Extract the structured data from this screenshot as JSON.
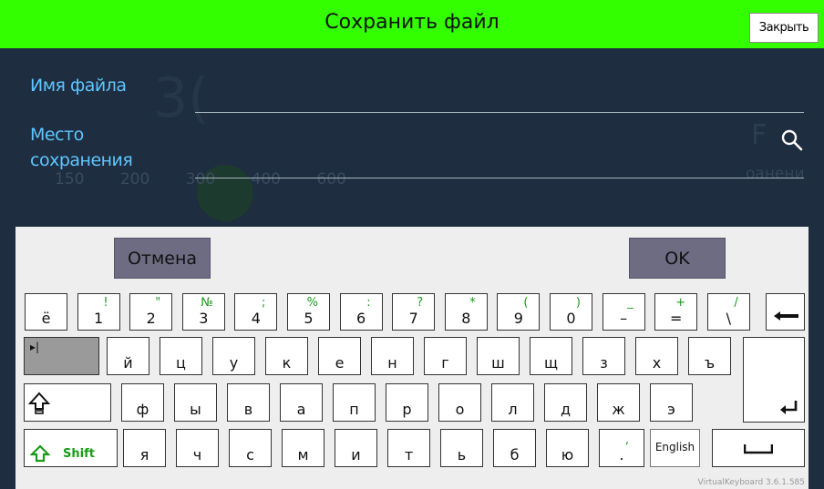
{
  "window": {
    "title": "Сохранить файл",
    "close_label": "Закрыть"
  },
  "background": {
    "big_number": "3(",
    "letter": "F",
    "numbers": "150 200 300 400 600",
    "right_text": "оанени"
  },
  "form": {
    "filename_label": "Имя файла",
    "filename_value": "",
    "location_label_line1": "Место",
    "location_label_line2": "сохранения",
    "location_value": ""
  },
  "keyboard": {
    "cancel_label": "Отмена",
    "ok_label": "OK",
    "version": "VirtualKeyboard 3.6.1.585",
    "shift_label": "Shift",
    "language_label": "English",
    "tab_symbol": "▸|",
    "row1": [
      {
        "main": "ё",
        "sub": ""
      },
      {
        "main": "1",
        "sub": "!"
      },
      {
        "main": "2",
        "sub": "\""
      },
      {
        "main": "3",
        "sub": "№"
      },
      {
        "main": "4",
        "sub": ";"
      },
      {
        "main": "5",
        "sub": "%"
      },
      {
        "main": "6",
        "sub": ":"
      },
      {
        "main": "7",
        "sub": "?"
      },
      {
        "main": "8",
        "sub": "*"
      },
      {
        "main": "9",
        "sub": "("
      },
      {
        "main": "0",
        "sub": ")"
      },
      {
        "main": "–",
        "sub": "_"
      },
      {
        "main": "=",
        "sub": "+"
      },
      {
        "main": "\\",
        "sub": "/"
      }
    ],
    "row2": [
      "й",
      "ц",
      "у",
      "к",
      "е",
      "н",
      "г",
      "ш",
      "щ",
      "з",
      "х",
      "ъ"
    ],
    "row3": [
      "ф",
      "ы",
      "в",
      "а",
      "п",
      "р",
      "о",
      "л",
      "д",
      "ж",
      "э"
    ],
    "row4": [
      "я",
      "ч",
      "с",
      "м",
      "и",
      "т",
      "ь",
      "б",
      "ю"
    ],
    "row4_punct": {
      "main": ".",
      "sub": ","
    },
    "colors": {
      "title_bar": "#33ff00",
      "dialog_bg": "#1e2d3f",
      "label": "#5fc6ff",
      "action_button": "#6d6c83",
      "shift_text": "#1a9a1a"
    }
  }
}
